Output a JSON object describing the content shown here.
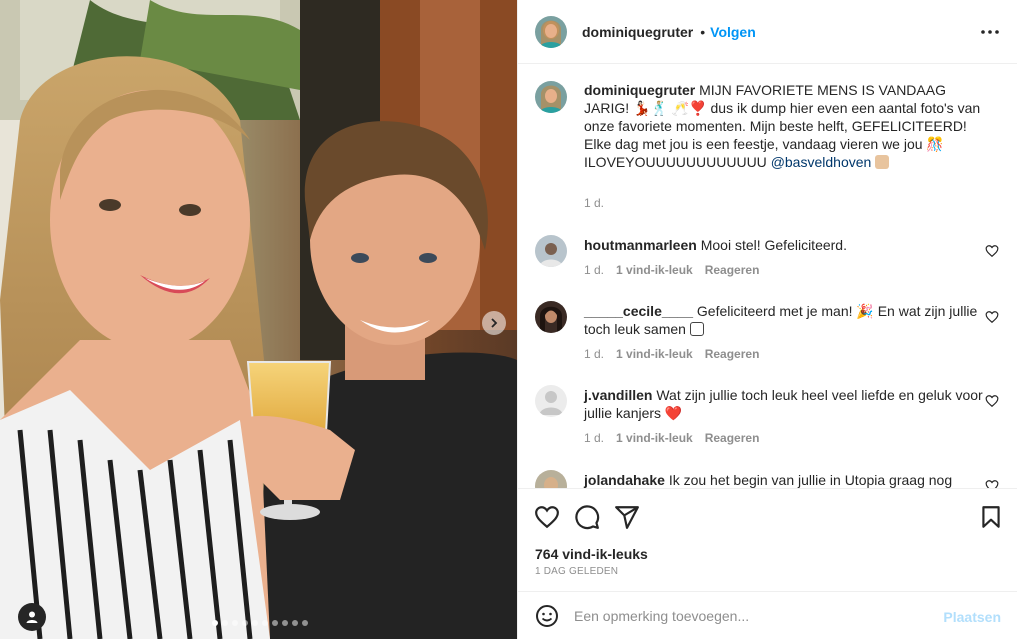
{
  "post": {
    "username": "dominiquegruter",
    "follow_label": "Volgen",
    "separator": "•",
    "more_icon": "more-horizontal-icon"
  },
  "caption": {
    "username": "dominiquegruter",
    "text_1": "MIJN FAVORIETE MENS IS VANDAAG JARIG! 💃🏻🕺🏼 🥂❣️ dus ik dump hier even een aantal foto's van onze favoriete momenten. Mijn beste helft, GEFELICITEERD! Elke dag met jou is een feestje, vandaag vieren we jou 🎊 ILOVEYOUUUUUUUUUUUU",
    "mention": "@basveldhoven",
    "time": "1 d."
  },
  "comments": [
    {
      "username": "houtmanmarleen",
      "text": "Mooi stel! Gefeliciteerd.",
      "time": "1 d.",
      "likes": "1 vind-ik-leuk",
      "reply": "Reageren"
    },
    {
      "username": "_____cecile____",
      "text": "Gefeliciteerd met je man! 🎉 En wat zijn jullie toch leuk samen",
      "time": "1 d.",
      "likes": "1 vind-ik-leuk",
      "reply": "Reageren"
    },
    {
      "username": "j.vandillen",
      "text": "Wat zijn jullie toch leuk heel veel liefde en geluk voor jullie kanjers ❤️",
      "time": "1 d.",
      "likes": "1 vind-ik-leuk",
      "reply": "Reageren"
    },
    {
      "username": "jolandahake",
      "text": "Ik zou het begin van jullie in Utopia graag nog"
    }
  ],
  "actions": {
    "like_icon": "heart-icon",
    "comment_icon": "comment-icon",
    "share_icon": "paper-plane-icon",
    "save_icon": "bookmark-icon"
  },
  "likes_count": "764 vind-ik-leuks",
  "posted_ago": "1 DAG GELEDEN",
  "composer": {
    "placeholder": "Een opmerking toevoegen...",
    "post_label": "Plaatsen"
  },
  "carousel": {
    "count": 10,
    "active_index": 0
  },
  "colors": {
    "accent": "#0095f6",
    "text": "#262626",
    "muted": "#8e8e8e",
    "border": "#efefef",
    "post_disabled": "#b2dffc"
  }
}
